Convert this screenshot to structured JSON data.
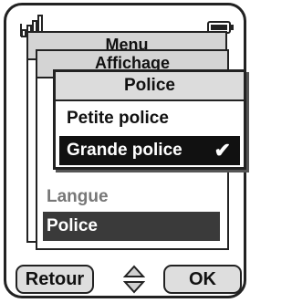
{
  "status": {
    "signal_icon": "signal-strength-icon",
    "battery_icon": "battery-icon"
  },
  "menu_stack": {
    "layer1_title": "Menu",
    "layer2_title": "Affichage",
    "underlay_items": [
      {
        "label": "Langue",
        "selected": false
      },
      {
        "label": "Police",
        "selected": true
      }
    ]
  },
  "popup": {
    "title": "Police",
    "options": [
      {
        "label": "Petite police",
        "selected": false
      },
      {
        "label": "Grande police",
        "selected": true
      }
    ],
    "check_mark": "✔"
  },
  "softkeys": {
    "left_label": "Retour",
    "right_label": "OK",
    "nav_icon": "up-down-arrows-icon"
  }
}
